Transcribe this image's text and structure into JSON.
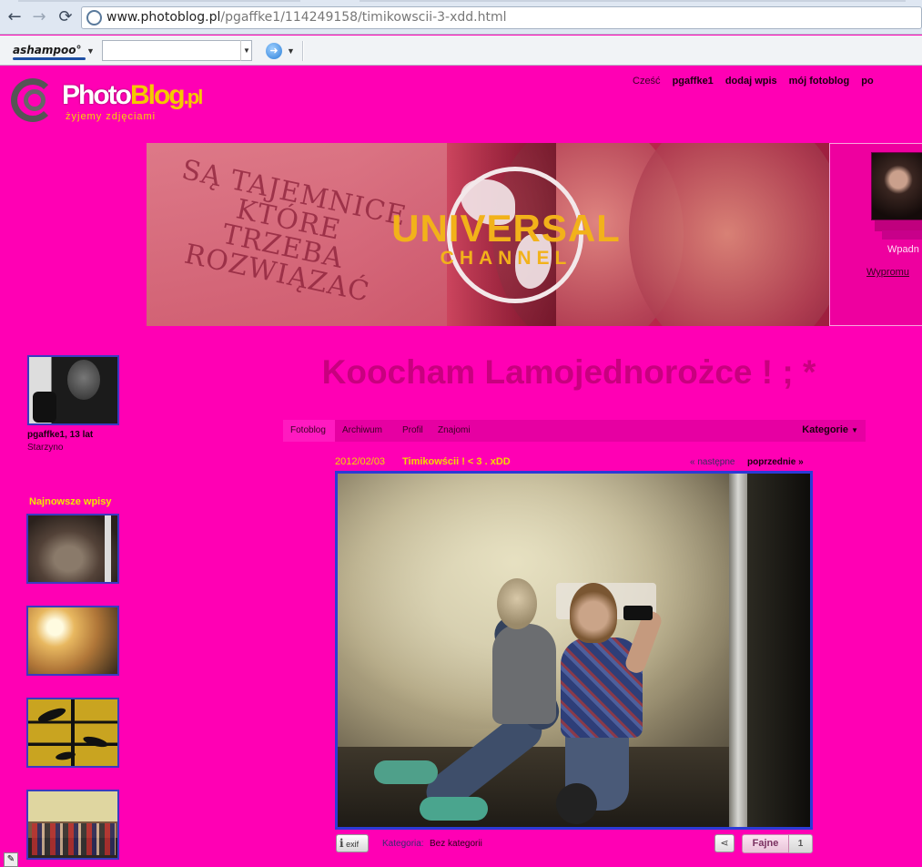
{
  "browser": {
    "back_icon": "back-arrow-icon",
    "forward_icon": "forward-arrow-icon",
    "reload_icon": "reload-icon",
    "url_host": "www.photoblog.pl",
    "url_path": "/pgaffke1/114249158/timikowscii-3-xdd.html"
  },
  "toolbar": {
    "brand": "ashampoo°",
    "search_placeholder": "",
    "go_icon": "go-arrow-icon"
  },
  "header": {
    "logo_part1": "Photo",
    "logo_part2": "Blog",
    "logo_part3": ".pl",
    "tagline": "żyjemy zdjęciami",
    "nav": {
      "greeting": "Cześć",
      "username": "pgaffke1",
      "add_entry": "dodaj wpis",
      "my_photoblog": "mój fotoblog",
      "more": "po"
    }
  },
  "banner": {
    "slogan": "SĄ TAJEMNICE KTÓRE TRZEBA ROZWIĄZAĆ",
    "brand_main": "UNIVERSAL",
    "brand_sub": "CHANNEL"
  },
  "user_panel": {
    "visit_label": "Wpadn",
    "promote_label": "Wypromu"
  },
  "sidebar": {
    "profile_name": "pgaffke1, 13 lat",
    "profile_city": "Starzyno",
    "latest_title": "Najnowsze wpisy"
  },
  "blog": {
    "title": "Koocham Lamojednorożce ! ; *",
    "menu": {
      "items": [
        "Fotoblog",
        "Archiwum",
        "Profil",
        "Znajomi"
      ],
      "categories": "Kategorie"
    },
    "entry": {
      "date": "2012/02/03",
      "title": "Timikowścii ! < 3 . xDD",
      "next": "« następne",
      "prev": "poprzednie »",
      "exif": "exif",
      "category_label": "Kategoria:",
      "category_value": "Bez kategorii",
      "like_label": "Fajne",
      "like_count": "1"
    }
  },
  "colors": {
    "page_background": "#ff00b4",
    "accent_yellow": "#f5d800",
    "title_pink": "#c8007f",
    "photo_border": "#2b3bd6"
  }
}
